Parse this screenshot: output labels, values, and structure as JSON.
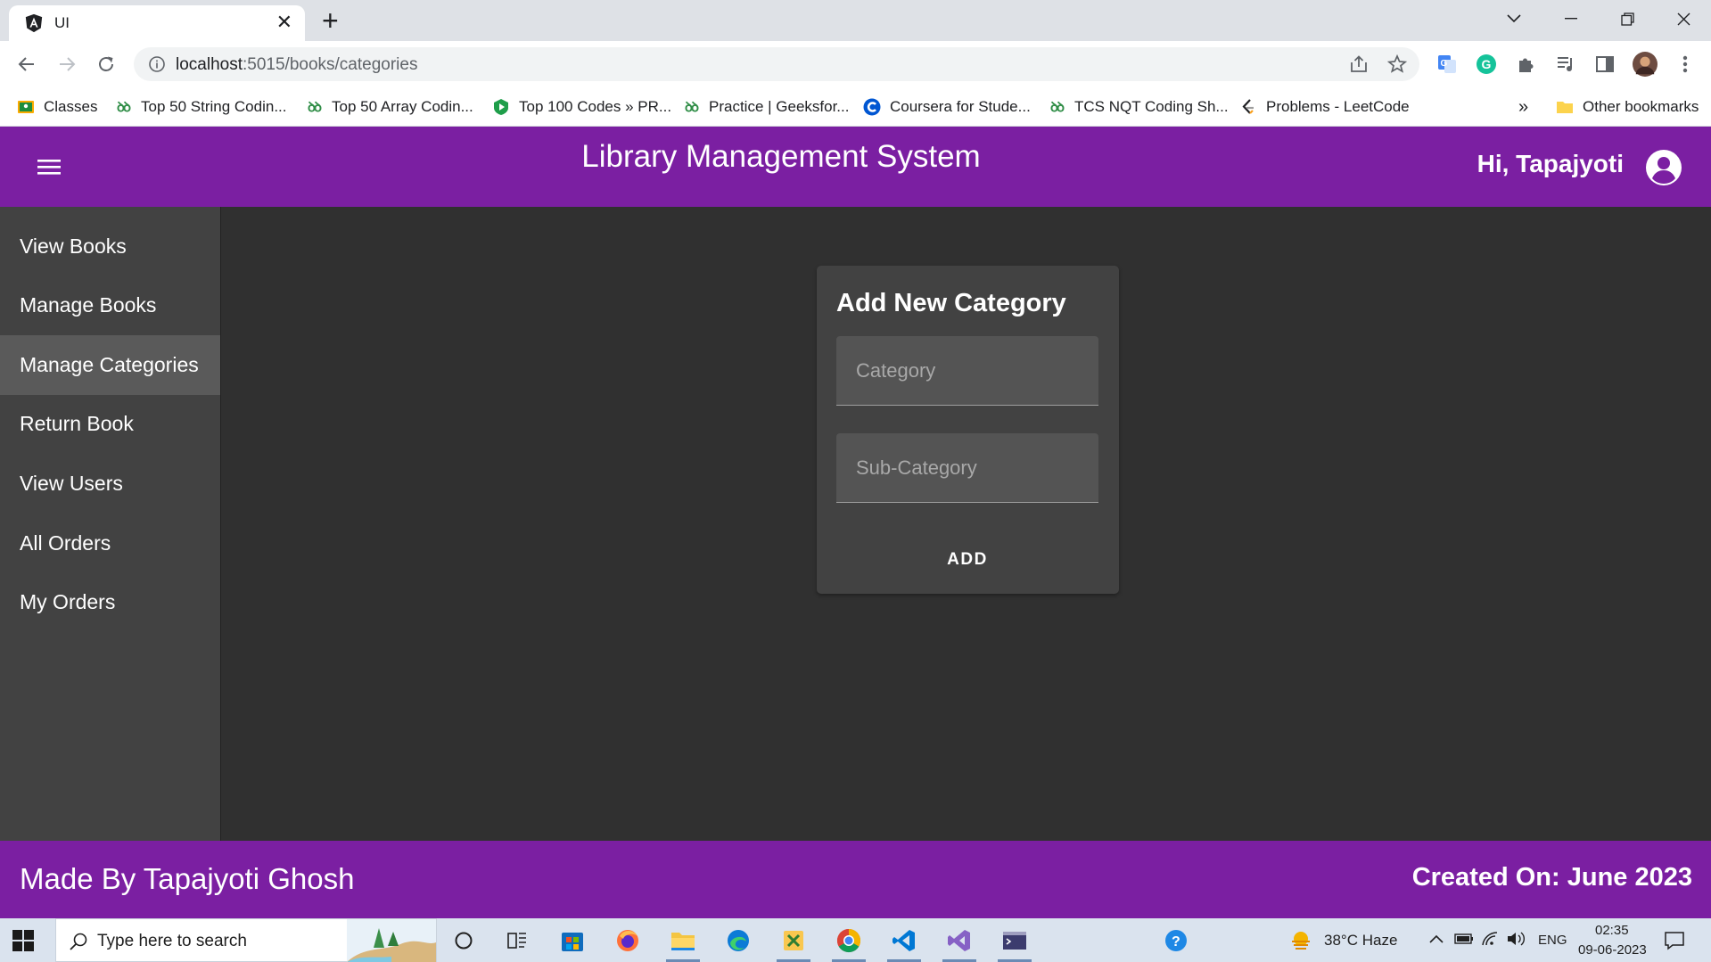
{
  "browser": {
    "tab_title": "UI",
    "tab_close": "✕",
    "new_tab": "+",
    "url_host": "localhost",
    "url_path": ":5015/books/categories",
    "bookmarks": [
      {
        "label": "Classes",
        "icon": "classroom-icon"
      },
      {
        "label": "Top 50 String Codin...",
        "icon": "geeksforgeeks-icon"
      },
      {
        "label": "Top 50 Array Codin...",
        "icon": "geeksforgeeks-icon"
      },
      {
        "label": "Top 100 Codes » PR...",
        "icon": "shield-icon"
      },
      {
        "label": "Practice | Geeksfor...",
        "icon": "geeksforgeeks-icon"
      },
      {
        "label": "Coursera for Stude...",
        "icon": "coursera-icon"
      },
      {
        "label": "TCS NQT Coding Sh...",
        "icon": "geeksforgeeks-icon"
      },
      {
        "label": "Problems - LeetCode",
        "icon": "leetcode-icon"
      }
    ],
    "bookmarks_overflow": "»",
    "other_bookmarks": "Other bookmarks"
  },
  "app": {
    "title": "Library Management System",
    "greeting": "Hi, Tapajyoti",
    "accent_color": "#7b1fa2",
    "nav_items": [
      {
        "label": "View Books",
        "active": false
      },
      {
        "label": "Manage Books",
        "active": false
      },
      {
        "label": "Manage Categories",
        "active": true
      },
      {
        "label": "Return Book",
        "active": false
      },
      {
        "label": "View Users",
        "active": false
      },
      {
        "label": "All Orders",
        "active": false
      },
      {
        "label": "My Orders",
        "active": false
      }
    ],
    "form": {
      "title": "Add New Category",
      "category_placeholder": "Category",
      "category_value": "",
      "subcategory_placeholder": "Sub-Category",
      "subcategory_value": "",
      "submit_label": "ADD"
    },
    "footer": {
      "left": "Made By Tapajyoti Ghosh",
      "right": "Created On: June 2023"
    }
  },
  "taskbar": {
    "search_placeholder": "Type here to search",
    "weather": "38°C  Haze",
    "language": "ENG",
    "time": "02:35",
    "date": "09-06-2023"
  }
}
